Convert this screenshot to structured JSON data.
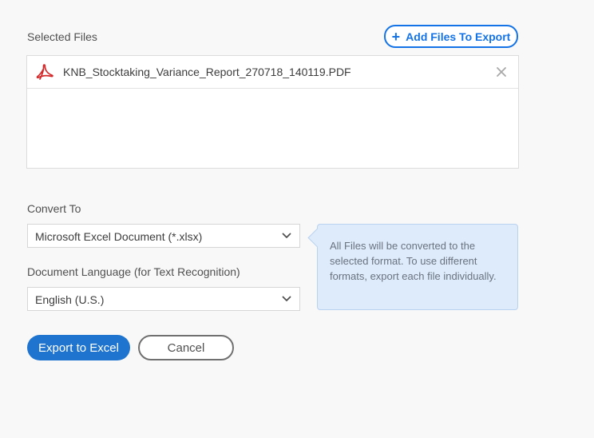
{
  "selected_files": {
    "label": "Selected Files",
    "add_button_label": "Add Files To Export",
    "files": [
      {
        "name": "KNB_Stocktaking_Variance_Report_270718_140119.PDF",
        "icon": "pdf-icon"
      }
    ]
  },
  "convert_to": {
    "label": "Convert To",
    "selected": "Microsoft Excel Document (*.xlsx)"
  },
  "document_language": {
    "label": "Document Language (for Text Recognition)",
    "selected": "English (U.S.)"
  },
  "tooltip": {
    "text": "All Files will be converted to the selected format. To use different formats, export each file individually."
  },
  "actions": {
    "primary_label": "Export to Excel",
    "cancel_label": "Cancel"
  },
  "colors": {
    "accent": "#1473e6",
    "primary_button": "#1f74cf",
    "pdf_red": "#d4292a",
    "tooltip_bg": "#deebfa"
  }
}
